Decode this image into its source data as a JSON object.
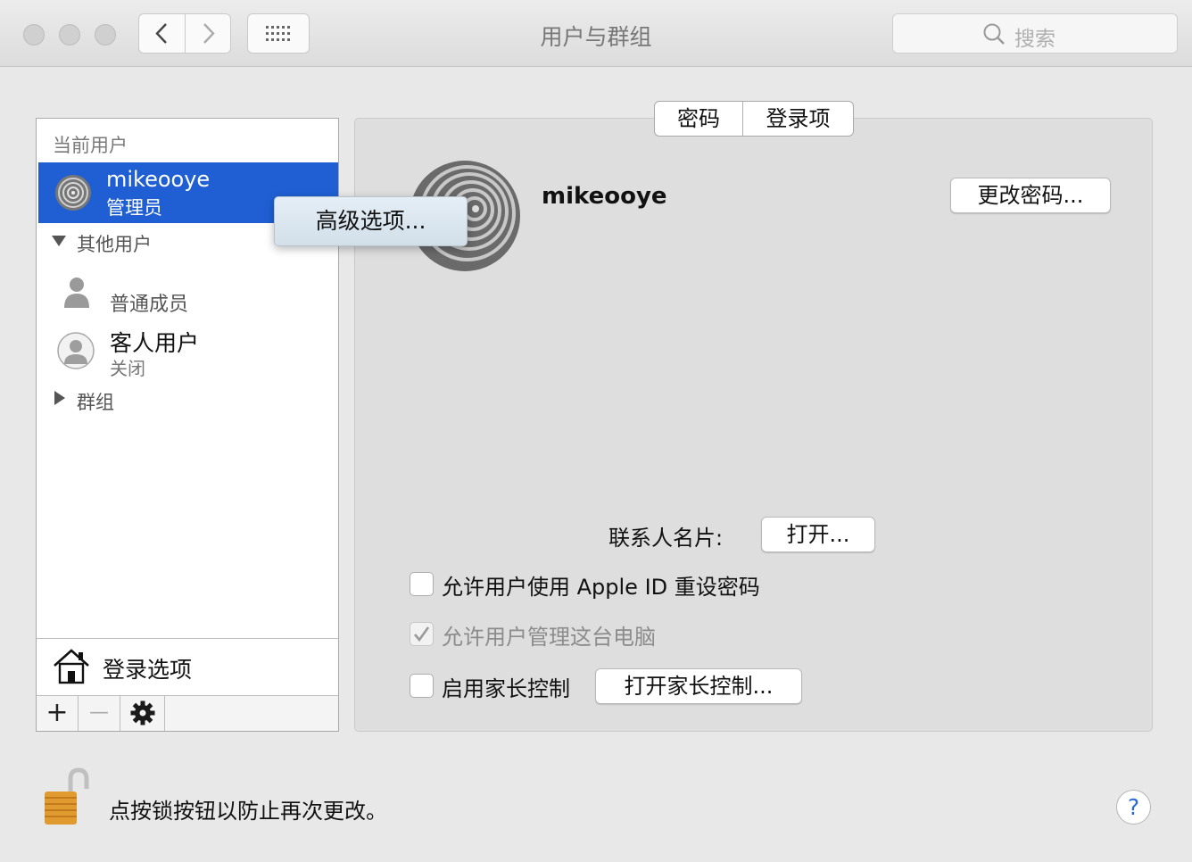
{
  "window": {
    "title": "用户与群组"
  },
  "search": {
    "placeholder": "搜索"
  },
  "sidebar": {
    "current_users_header": "当前用户",
    "current_user": {
      "name": "mikeooye",
      "role": "管理员"
    },
    "other_users_header": "其他用户",
    "other_users": [
      {
        "name": "普通成员"
      },
      {
        "name": "客人用户",
        "status": "关闭"
      }
    ],
    "groups_header": "群组",
    "login_options_label": "登录选项",
    "toolbar": {
      "add": "+",
      "remove": "—"
    }
  },
  "context_menu": {
    "items": [
      "高级选项..."
    ]
  },
  "tabs": {
    "items": [
      "密码",
      "登录项"
    ],
    "selected": "登录项"
  },
  "profile": {
    "username": "mikeooye",
    "change_password_label": "更改密码..."
  },
  "contact_card": {
    "label": "联系人名片:",
    "open_label": "打开..."
  },
  "checkboxes": [
    {
      "label": "允许用户使用 Apple ID 重设密码",
      "checked": false,
      "enabled": true
    },
    {
      "label": "允许用户管理这台电脑",
      "checked": true,
      "enabled": false
    },
    {
      "label": "启用家长控制",
      "checked": false,
      "enabled": true
    }
  ],
  "parental_controls": {
    "open_label": "打开家长控制..."
  },
  "footer": {
    "lock_text": "点按锁按钮以防止再次更改。",
    "help_label": "?"
  },
  "colors": {
    "selection": "#1f5fd3",
    "panel": "#dedede",
    "window": "#e8e8e8",
    "help": "#2a68d9"
  }
}
